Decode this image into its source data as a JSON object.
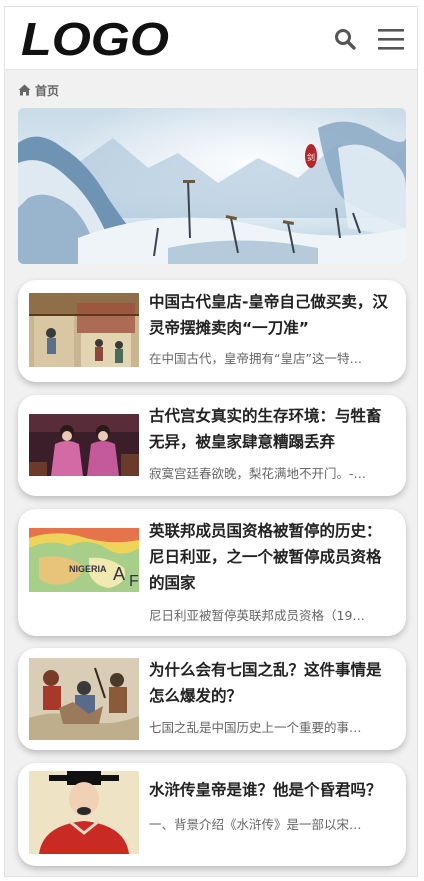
{
  "header": {
    "logo_text": "LOGO",
    "search_icon": "search-icon",
    "menu_icon": "hamburger-menu-icon"
  },
  "breadcrumb": {
    "home_icon": "home-icon",
    "home_label": "首页"
  },
  "banner": {
    "seal_text": "剑",
    "scene": "snowy-mountain-swords"
  },
  "articles": [
    {
      "title": "中国古代皇店-皇帝自己做买卖，汉灵帝摆摊卖肉“一刀准”",
      "excerpt": "在中国古代，皇帝拥有“皇店”这一特…",
      "thumb": "ancient-painting-palace"
    },
    {
      "title": "古代宫女真实的生存环境：与牲畜无异，被皇家肆意糟蹋丢弃",
      "excerpt": "寂寞宫廷春欲晚，梨花满地不开门。-…",
      "thumb": "palace-maids-drama"
    },
    {
      "title": "英联邦成员国资格被暂停的历史：尼日利亚，之一个被暂停成员资格的国家",
      "excerpt": "尼日利亚被暂停英联邦成员资格（19…",
      "thumb": "nigeria-map"
    },
    {
      "title": "为什么会有七国之乱？这件事情是怎么爆发的？",
      "excerpt": "七国之乱是中国历史上一个重要的事…",
      "thumb": "ancient-battle-painting"
    },
    {
      "title": "水浒传皇帝是谁？他是个昏君吗？",
      "excerpt": "一、背景介绍《水浒传》是一部以宋…",
      "thumb": "emperor-portrait"
    }
  ],
  "colors": {
    "background": "#f1f1f1",
    "card": "#ffffff",
    "title": "#222222",
    "excerpt": "#666666",
    "icon": "#555555"
  }
}
